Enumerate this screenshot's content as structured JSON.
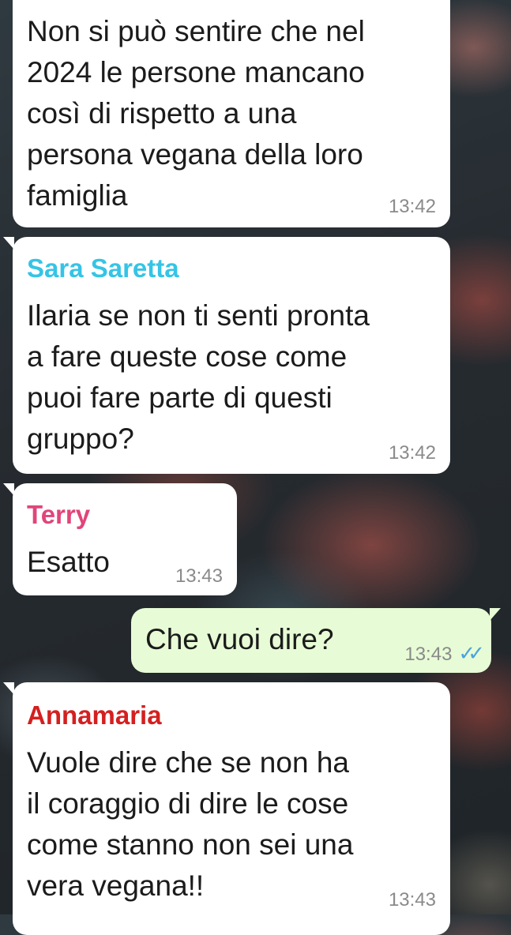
{
  "messages": [
    {
      "type": "incoming",
      "text": "Non si può sentire che nel\n2024 le persone mancano\ncosì di rispetto a una\npersona vegana della loro\nfamiglia",
      "time": "13:42"
    },
    {
      "type": "incoming",
      "sender": "Sara Saretta",
      "sender_color": "#35c4e6",
      "text": "Ilaria se non ti senti pronta\na fare queste cose come\npuoi fare parte di questi\ngruppo?",
      "time": "13:42"
    },
    {
      "type": "incoming",
      "sender": "Terry",
      "sender_color": "#e0457b",
      "text": "Esatto",
      "time": "13:43"
    },
    {
      "type": "outgoing",
      "text": "Che vuoi dire?",
      "time": "13:43",
      "status_icon": "double-check-icon"
    },
    {
      "type": "incoming",
      "sender": "Annamaria",
      "sender_color": "#d42020",
      "text": "Vuole dire che se non ha\nil coraggio di dire le cose\ncome stanno non sei una\nvera vegana!!",
      "time": "13:43"
    }
  ]
}
